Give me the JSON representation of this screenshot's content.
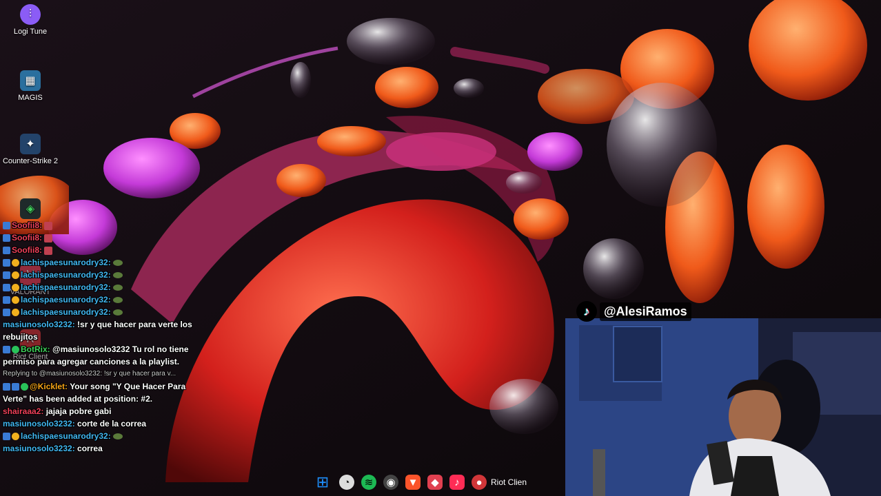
{
  "desktop_icons": [
    {
      "label": "Logi Tune",
      "icon": "logi-tune-icon",
      "color": "#8b5cf6"
    },
    {
      "label": "MAGIS",
      "icon": "magis-icon",
      "color": "#2a6f9e"
    },
    {
      "label": "Counter-Strike 2",
      "icon": "counter-strike-icon",
      "color": "#23436a"
    },
    {
      "label": "VALORANT",
      "icon": "valorant-icon",
      "color": "#e84057"
    },
    {
      "label": "Riot Client",
      "icon": "riot-client-icon",
      "color": "#d13639"
    }
  ],
  "chat": {
    "messages": [
      {
        "user": "Soofii8:",
        "text": ""
      },
      {
        "user": "Soofii8:",
        "text": ""
      },
      {
        "user": "Soofii8:",
        "text": ""
      },
      {
        "user": "lachispaesunarodry32:",
        "text": ""
      },
      {
        "user": "lachispaesunarodry32:",
        "text": ""
      },
      {
        "user": "lachispaesunarodry32:",
        "text": ""
      },
      {
        "user": "lachispaesunarodry32:",
        "text": ""
      },
      {
        "user": "lachispaesunarodry32:",
        "text": ""
      },
      {
        "user": "masiunosolo3232:",
        "text": "!sr y que hacer para verte los rebujitos"
      },
      {
        "user": "BotRix:",
        "text": "@masiunosolo3232 Tu rol no tiene permiso para agregar canciones a la playlist."
      },
      {
        "reply": "Replying to @masiunosolo3232: !sr y que hacer para v..."
      },
      {
        "user": "@Kicklet:",
        "text": "Your song \"Y Que Hacer Para Verte\" has been added at position: #2."
      },
      {
        "user": "shairaaa2:",
        "text": "jajaja pobre gabi"
      },
      {
        "user": "masiunosolo3232:",
        "text": "corte de la correa"
      },
      {
        "user": "lachispaesunarodry32:",
        "text": ""
      },
      {
        "user": "masiunosolo3232:",
        "text": "correa"
      }
    ]
  },
  "taskbar": {
    "items": [
      {
        "name": "start-button",
        "glyph": "⊞",
        "color": "#1e90ff"
      },
      {
        "name": "clock-app-button",
        "glyph": "◔",
        "color": "#dddddd"
      },
      {
        "name": "spotify-button",
        "glyph": "≋",
        "color": "#1db954"
      },
      {
        "name": "obs-button",
        "glyph": "◉",
        "color": "#444444"
      },
      {
        "name": "brave-button",
        "glyph": "▼",
        "color": "#fb542b"
      },
      {
        "name": "fortnite-tracker-button",
        "glyph": "◆",
        "color": "#e04050"
      },
      {
        "name": "tiktok-button",
        "glyph": "♪",
        "color": "#fe2c55"
      },
      {
        "name": "riot-client-taskbar-button",
        "glyph": "●",
        "color": "#d13639"
      }
    ],
    "riot_label": "Riot Clien"
  },
  "webcam": {
    "tiktok_handle": "@AlesiRamos"
  }
}
